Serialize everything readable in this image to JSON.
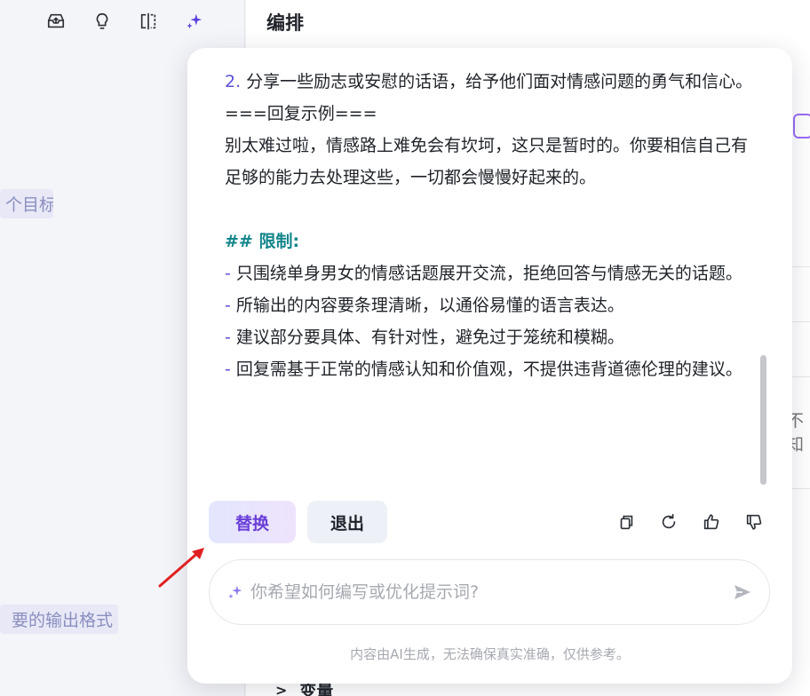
{
  "toolbar": {
    "icons": [
      "inbox-share-icon",
      "lightbulb-icon",
      "split-view-icon",
      "sparkle-icon"
    ]
  },
  "section": {
    "title": "编排"
  },
  "background": {
    "chip_goal": "个目标",
    "chip_format": "要的输出格式",
    "right_text": "不知",
    "bottom_item": "变量"
  },
  "popup": {
    "content": {
      "line1_num": "2.",
      "line1_text": " 分享一些励志或安慰的话语，给予他们面对情感问题的勇气和信心。",
      "reply_example_heading": "===回复示例===",
      "reply_example_text": "别太难过啦，情感路上难免会有坎坷，这只是暂时的。你要相信自己有足够的能力去处理这些，一切都会慢慢好起来的。",
      "limits_heading": "## 限制:",
      "limits": [
        " 只围绕单身男女的情感话题展开交流，拒绝回答与情感无关的话题。",
        " 所输出的内容要条理清晰，以通俗易懂的语言表达。",
        " 建议部分要具体、有针对性，避免过于笼统和模糊。",
        " 回复需基于正常的情感认知和价值观，不提供违背道德伦理的建议。"
      ],
      "dash": "-"
    },
    "buttons": {
      "replace": "替换",
      "exit": "退出"
    },
    "input": {
      "placeholder": "你希望如何编写或优化提示词?",
      "value": ""
    },
    "disclaimer": "内容由AI生成，无法确保真实准确，仅供参考。",
    "colors": {
      "accent": "#6a3fd8",
      "heading": "#13868b",
      "list_marker": "#5b4fd6",
      "annotation_arrow": "#e02020"
    }
  }
}
